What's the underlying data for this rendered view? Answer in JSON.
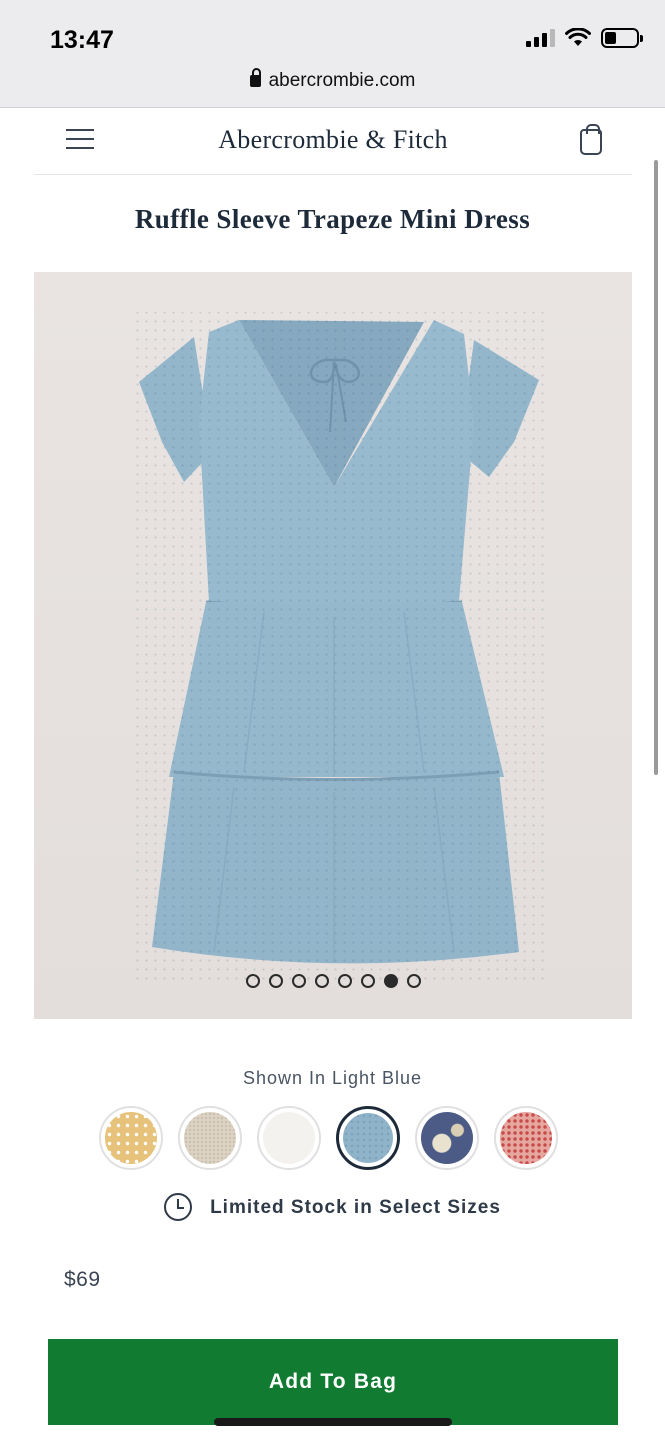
{
  "status_bar": {
    "time": "13:47"
  },
  "browser": {
    "url": "abercrombie.com"
  },
  "header": {
    "brand": "Abercrombie & Fitch"
  },
  "product": {
    "title": "Ruffle Sleeve Trapeze Mini Dress",
    "image_description_icon": "dress-image",
    "carousel": {
      "total": 8,
      "active_index": 6
    },
    "shown_in_label": "Shown In Light Blue",
    "swatches": [
      {
        "name": "yellow-print",
        "color": "#e6c27a",
        "selected": false
      },
      {
        "name": "oatmeal",
        "color": "#dcd4c6",
        "selected": false
      },
      {
        "name": "white",
        "color": "#f4f2ee",
        "selected": false
      },
      {
        "name": "light-blue",
        "color": "#8fb4c9",
        "selected": true
      },
      {
        "name": "navy-floral",
        "color": "#4b5b86",
        "selected": false
      },
      {
        "name": "pink-floral",
        "color": "#e5a7a0",
        "selected": false
      }
    ],
    "stock_message": "Limited Stock in Select Sizes",
    "price": "$69"
  },
  "actions": {
    "add_to_bag": "Add To Bag"
  },
  "colors": {
    "cta_green": "#107b31",
    "text_navy": "#1d2a3a"
  }
}
